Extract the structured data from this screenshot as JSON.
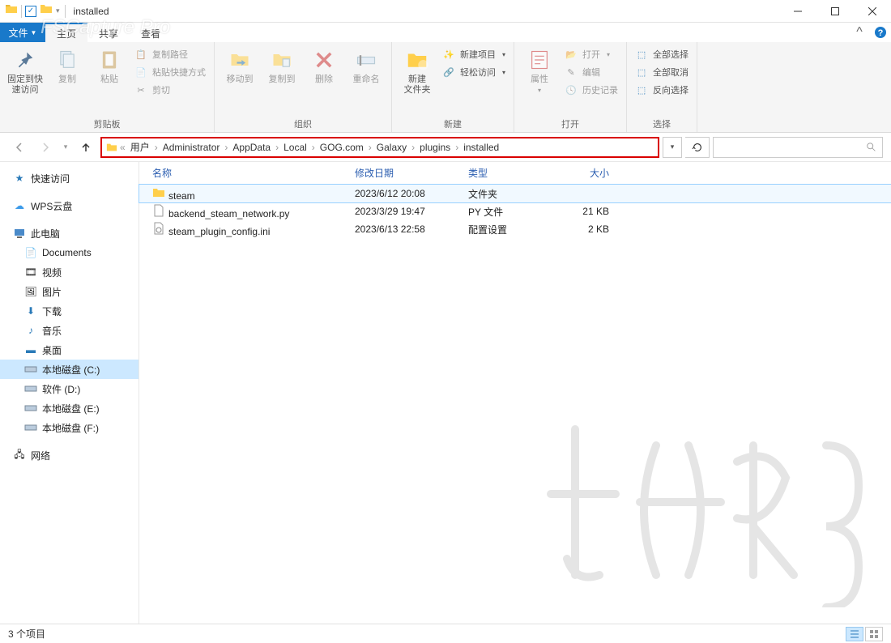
{
  "title": "installed",
  "tabs": {
    "file": "文件",
    "home": "主页",
    "share": "共享",
    "view": "查看"
  },
  "ribbon": {
    "clipboard": {
      "pin": "固定到快\n速访问",
      "copy": "复制",
      "paste": "粘贴",
      "copy_path": "复制路径",
      "paste_shortcut": "粘贴快捷方式",
      "cut": "剪切",
      "label": "剪贴板"
    },
    "organize": {
      "move_to": "移动到",
      "copy_to": "复制到",
      "delete": "删除",
      "rename": "重命名",
      "label": "组织"
    },
    "new": {
      "new_folder": "新建\n文件夹",
      "new_item": "新建项目",
      "easy_access": "轻松访问",
      "label": "新建"
    },
    "open": {
      "properties": "属性",
      "open": "打开",
      "edit": "编辑",
      "history": "历史记录",
      "label": "打开"
    },
    "select": {
      "select_all": "全部选择",
      "select_none": "全部取消",
      "invert": "反向选择",
      "label": "选择"
    }
  },
  "breadcrumb": [
    "用户",
    "Administrator",
    "AppData",
    "Local",
    "GOG.com",
    "Galaxy",
    "plugins",
    "installed"
  ],
  "search_placeholder": "",
  "sidebar": {
    "quick": "快速访问",
    "wps": "WPS云盘",
    "thispc": "此电脑",
    "items": [
      "Documents",
      "视频",
      "图片",
      "下载",
      "音乐",
      "桌面",
      "本地磁盘 (C:)",
      "软件 (D:)",
      "本地磁盘 (E:)",
      "本地磁盘 (F:)"
    ],
    "network": "网络"
  },
  "columns": {
    "name": "名称",
    "date": "修改日期",
    "type": "类型",
    "size": "大小"
  },
  "files": [
    {
      "name": "steam",
      "date": "2023/6/12 20:08",
      "type": "文件夹",
      "size": "",
      "kind": "folder"
    },
    {
      "name": "backend_steam_network.py",
      "date": "2023/3/29 19:47",
      "type": "PY 文件",
      "size": "21 KB",
      "kind": "py"
    },
    {
      "name": "steam_plugin_config.ini",
      "date": "2023/6/13 22:58",
      "type": "配置设置",
      "size": "2 KB",
      "kind": "ini"
    }
  ],
  "status": "3 个项目",
  "watermark_app": "FSCapture Pro"
}
